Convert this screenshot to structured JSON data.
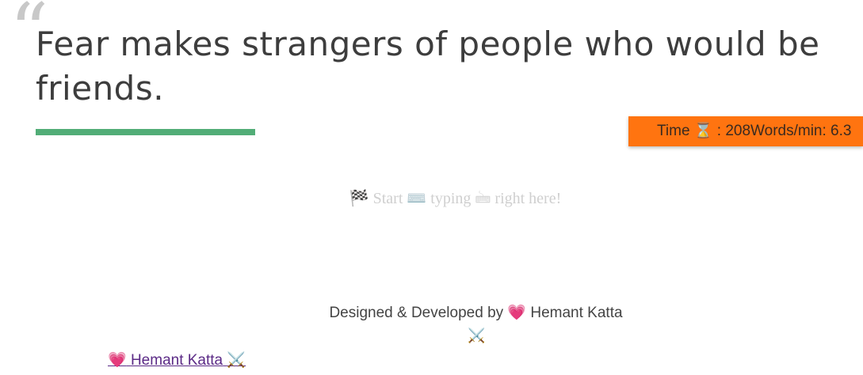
{
  "quote": {
    "mark": "“",
    "text": "Fear makes strangers of people who would be friends."
  },
  "progress": {
    "fraction": 0.277,
    "color": "#52ad77"
  },
  "stats": {
    "time_label": "Time",
    "time_icon": "⌛",
    "time_sep": ":",
    "time_value": "208",
    "wpm_label": "Words/min:",
    "wpm_value": "6.3",
    "background": "#ff7410"
  },
  "input": {
    "placeholder": "🏁 Start ⌨️ typing 🖮 right here!",
    "value": ""
  },
  "footer": {
    "text": "Designed & Developed by",
    "heart": "💗",
    "author": "Hemant Katta",
    "swords": "⚔️"
  },
  "author_link": {
    "heart": "💗",
    "label": "Hemant Katta",
    "swords": "⚔️"
  }
}
